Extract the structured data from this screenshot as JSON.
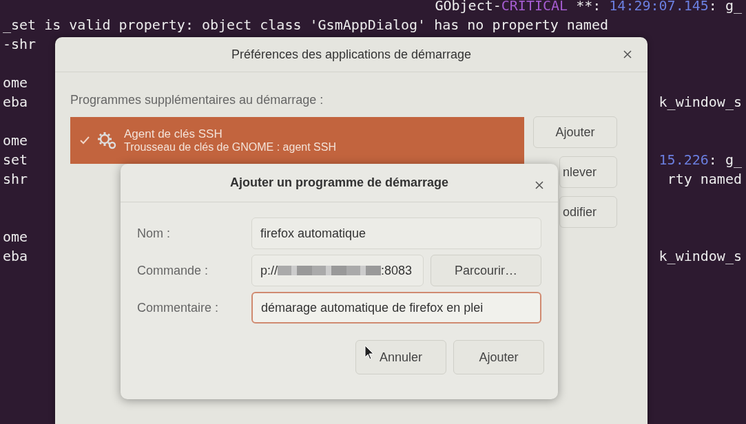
{
  "terminal": {
    "lines": [
      {
        "right": [
          {
            "text": "GObject-",
            "kind": "plain"
          },
          {
            "text": "CRITICAL",
            "kind": "critical"
          },
          {
            "text": " **: ",
            "kind": "plain"
          },
          {
            "text": "14:29:07.145",
            "kind": "time"
          },
          {
            "text": ": g_",
            "kind": "plain"
          }
        ]
      },
      {
        "left": [
          {
            "text": "_set is valid property: object class 'GsmAppDialog' has no property named",
            "kind": "plain"
          }
        ]
      },
      {
        "left": [
          {
            "text": "-shr",
            "kind": "plain"
          }
        ]
      },
      {
        "left": [
          {
            "text": "ome",
            "kind": "plain"
          }
        ]
      },
      {
        "left": [
          {
            "text": "eba",
            "kind": "plain"
          }
        ],
        "right": [
          {
            "text": "k_window_s",
            "kind": "plain"
          }
        ]
      },
      {
        "left": [
          {
            "text": "ome",
            "kind": "plain"
          }
        ]
      },
      {
        "left": [
          {
            "text": "set",
            "kind": "plain"
          }
        ],
        "right": [
          {
            "text": "15.226",
            "kind": "time"
          },
          {
            "text": ": g_",
            "kind": "plain"
          }
        ]
      },
      {
        "left": [
          {
            "text": "shr",
            "kind": "plain"
          }
        ],
        "right": [
          {
            "text": "rty named",
            "kind": "plain"
          }
        ]
      },
      {
        "left": [
          {
            "text": "ome",
            "kind": "plain"
          }
        ]
      },
      {
        "left": [
          {
            "text": "eba",
            "kind": "plain"
          }
        ],
        "right": [
          {
            "text": "k_window_s",
            "kind": "plain"
          }
        ]
      }
    ]
  },
  "preferences_dialog": {
    "title": "Préférences des applications de démarrage",
    "list_label": "Programmes supplémentaires au démarrage :",
    "programs": [
      {
        "name": "Agent de clés SSH",
        "description": "Trousseau de clés de GNOME : agent SSH",
        "enabled": true,
        "selected": true
      }
    ],
    "buttons": [
      "Ajouter",
      "nlever",
      "odifier"
    ]
  },
  "add_dialog": {
    "title": "Ajouter un programme de démarrage",
    "fields": [
      {
        "label": "Nom :",
        "kind": "text",
        "value": "firefox automatique",
        "focused": false
      },
      {
        "label": "Commande :",
        "kind": "command",
        "value_prefix": "p://",
        "value_suffix": ":8083",
        "button": "Parcourir…",
        "focused": false
      },
      {
        "label": "Commentaire :",
        "kind": "text",
        "value": "démarage automatique de firefox en plei",
        "focused": true
      }
    ],
    "buttons": [
      "Annuler",
      "Ajouter"
    ]
  }
}
